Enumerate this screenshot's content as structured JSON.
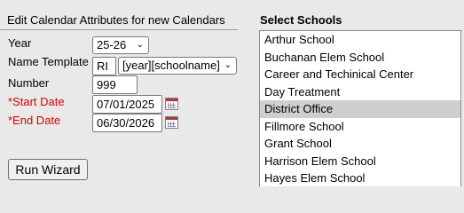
{
  "form": {
    "header": "Edit Calendar Attributes for new Calendars",
    "year_label": "Year",
    "year_value": "25-26",
    "name_template_label": "Name Template",
    "name_template_prefix": "RI",
    "name_template_pattern": "[year][schoolname]",
    "number_label": "Number",
    "number_value": "999",
    "start_date_label": "*Start Date",
    "start_date_value": "07/01/2025",
    "end_date_label": "*End Date",
    "end_date_value": "06/30/2026",
    "run_button_label": "Run Wizard"
  },
  "schools": {
    "header": "Select Schools",
    "items": [
      "Arthur School",
      "Buchanan Elem School",
      "Career and Techinical Center",
      "Day Treatment",
      "District Office",
      "Fillmore School",
      "Grant School",
      "Harrison Elem School",
      "Hayes Elem School"
    ],
    "selected": "District Office"
  },
  "icons": {
    "dropdown": "chevron-down-icon",
    "calendar": "calendar-icon"
  },
  "colors": {
    "required_label": "#e00000",
    "selected_row": "#cfcfcf",
    "background": "#e9e9e9"
  }
}
